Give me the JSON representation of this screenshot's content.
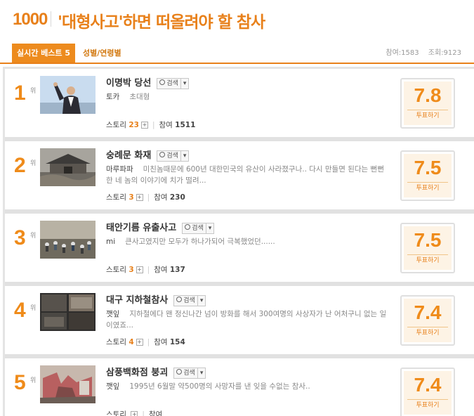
{
  "header": {
    "logo": "1000",
    "title": "'대형사고'하면 떠올려야 할 참사"
  },
  "tabs": {
    "active": "실시간 베스트 5",
    "other": "성별/연령별"
  },
  "stats": {
    "participants": "참여:1583",
    "views": "조회:9123"
  },
  "items": [
    {
      "rank": "1",
      "rank_suffix": "위",
      "title": "이명박 당선",
      "search_label": "검색",
      "author": "토카",
      "text": "초대형",
      "story_label": "스토리",
      "story_count": "23",
      "participants_label": "참여",
      "participants": "1511",
      "score": "7.8",
      "vote_label": "투표하기",
      "thumb_icon": "person-raising-arm-icon"
    },
    {
      "rank": "2",
      "rank_suffix": "위",
      "title": "숭례문 화재",
      "search_label": "검색",
      "author": "마루파파",
      "text": "미친놈때문에 600년 대한민국의 유산이 사라졌구나.. 다시 만들면 된다는 뻔뻔한 네 놈의 이야기에 치가 떨려...",
      "story_label": "스토리",
      "story_count": "3",
      "participants_label": "참여",
      "participants": "230",
      "score": "7.5",
      "vote_label": "투표하기",
      "thumb_icon": "burned-gate-icon"
    },
    {
      "rank": "3",
      "rank_suffix": "위",
      "title": "태안기름 유출사고",
      "search_label": "검색",
      "author": "mi",
      "text": "큰사고였지만 모두가 하나가되어 극복했었던......",
      "story_label": "스토리",
      "story_count": "3",
      "participants_label": "참여",
      "participants": "137",
      "score": "7.5",
      "vote_label": "투표하기",
      "thumb_icon": "beach-volunteers-icon"
    },
    {
      "rank": "4",
      "rank_suffix": "위",
      "title": "대구 지하철참사",
      "search_label": "검색",
      "author": "깻잎",
      "text": "지하철에다 왠 정신나간 넘이 방화를 해서 300여명의 사상자가 난 어처구니 없는 일이였죠...",
      "story_label": "스토리",
      "story_count": "4",
      "participants_label": "참여",
      "participants": "154",
      "score": "7.4",
      "vote_label": "투표하기",
      "thumb_icon": "burned-subway-icon"
    },
    {
      "rank": "5",
      "rank_suffix": "위",
      "title": "삼풍백화점 붕괴",
      "search_label": "검색",
      "author": "깻잎",
      "text": "1995년 6월말 약500명의 사망자를 낸 잊을 수없는 참사..",
      "story_label": "스토리",
      "story_count": "",
      "participants_label": "참여",
      "participants": "",
      "score": "7.4",
      "vote_label": "투표하기",
      "thumb_icon": "collapsed-building-icon"
    }
  ]
}
